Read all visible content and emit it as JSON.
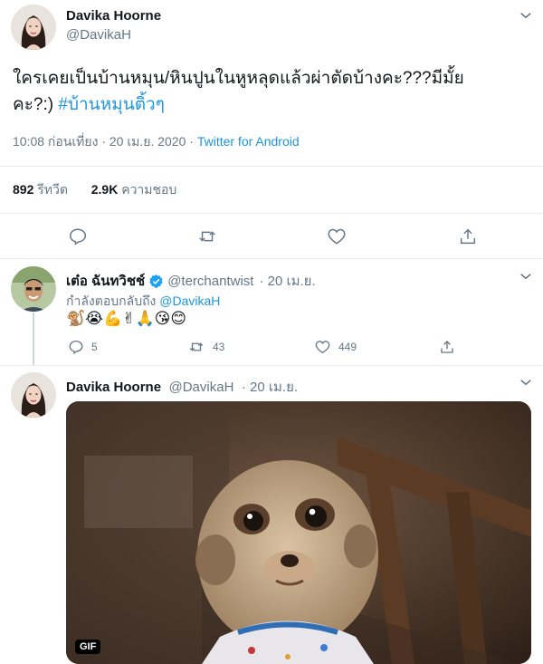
{
  "main_tweet": {
    "name": "Davika Hoorne",
    "handle": "@DavikaH",
    "text_line1": "ใครเคยเป็นบ้านหมุน/หินปูนในหูหลุดแล้วผ่าตัดบ้างคะ???มีมั้ย",
    "text_line2_plain": "คะ?:) ",
    "text_line2_hashtag": "#บ้านหมุนติ้วๆ",
    "timestamp": "10:08 ก่อนเที่ยง · 20 เม.ย. 2020 · ",
    "source": "Twitter for Android",
    "stats": {
      "retweets_count": "892",
      "retweets_label": "รีทวีต",
      "likes_count": "2.9K",
      "likes_label": "ความชอบ"
    }
  },
  "reply1": {
    "name": "เต๋อ ฉันทวิชช์",
    "handle": "@terchantwist",
    "date": "· 20 เม.ย.",
    "replying_prefix": "กำลังตอบกลับถึง ",
    "replying_handle": "@DavikaH",
    "emojis": "🐒😭💪✌🙏😘😊",
    "reply_count": "5",
    "retweet_count": "43",
    "like_count": "449"
  },
  "reply2": {
    "name": "Davika Hoorne",
    "handle": "@DavikaH",
    "date": "· 20 เม.ย.",
    "gif_badge": "GIF"
  },
  "colors": {
    "accent": "#1b95e0",
    "verified": "#1da1f2",
    "secondary_text": "#657786",
    "divider": "#e6ecf0"
  }
}
